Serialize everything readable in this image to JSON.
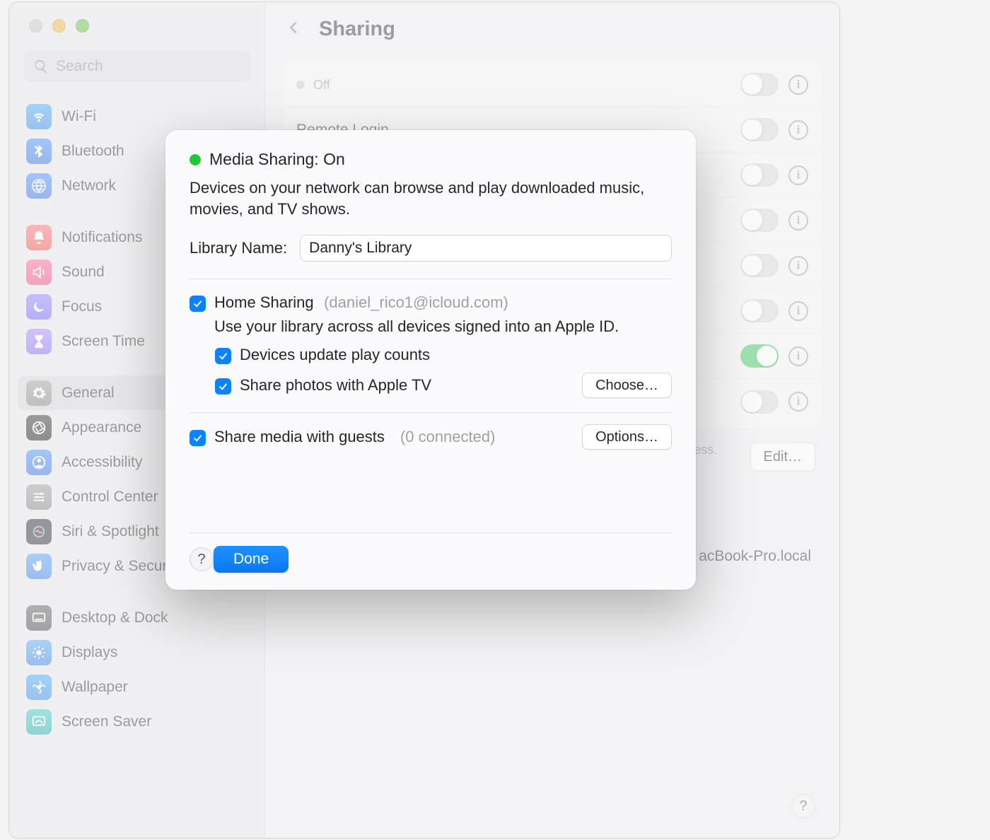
{
  "search_placeholder": "Search",
  "header": {
    "title": "Sharing"
  },
  "sidebar": {
    "groups": [
      [
        {
          "label": "Wi-Fi",
          "icon": "wifi-icon",
          "cls": "i-blue"
        },
        {
          "label": "Bluetooth",
          "icon": "bluetooth-icon",
          "cls": "i-blue2"
        },
        {
          "label": "Network",
          "icon": "globe-icon",
          "cls": "i-blue2"
        }
      ],
      [
        {
          "label": "Notifications",
          "icon": "bell-icon",
          "cls": "i-red"
        },
        {
          "label": "Sound",
          "icon": "speaker-icon",
          "cls": "i-pink"
        },
        {
          "label": "Focus",
          "icon": "moon-icon",
          "cls": "i-purp"
        },
        {
          "label": "Screen Time",
          "icon": "hourglass-icon",
          "cls": "i-pur2"
        }
      ],
      [
        {
          "label": "General",
          "icon": "gear-icon",
          "cls": "i-gray",
          "sel": true
        },
        {
          "label": "Appearance",
          "icon": "aperture-icon",
          "cls": "i-dark"
        },
        {
          "label": "Accessibility",
          "icon": "person-icon",
          "cls": "i-blue2"
        },
        {
          "label": "Control Center",
          "icon": "sliders-icon",
          "cls": "i-gray"
        },
        {
          "label": "Siri & Spotlight",
          "icon": "siri-icon",
          "cls": "i-siri"
        },
        {
          "label": "Privacy & Security",
          "icon": "hand-icon",
          "cls": "i-hand"
        }
      ],
      [
        {
          "label": "Desktop & Dock",
          "icon": "dock-icon",
          "cls": "i-dkgr"
        },
        {
          "label": "Displays",
          "icon": "sun-icon",
          "cls": "i-sun"
        },
        {
          "label": "Wallpaper",
          "icon": "flower-icon",
          "cls": "i-flower"
        },
        {
          "label": "Screen Saver",
          "icon": "screensaver-icon",
          "cls": "i-teal"
        }
      ]
    ]
  },
  "sharing_rows": [
    {
      "label": "",
      "sub": "Off",
      "on": false,
      "dot": true
    },
    {
      "label": "Remote Login",
      "on": false
    },
    {
      "label": "",
      "on": false
    },
    {
      "label": "",
      "on": false
    },
    {
      "label": "",
      "on": false
    },
    {
      "label": "",
      "on": false
    },
    {
      "label": "",
      "on": true
    },
    {
      "label": "",
      "on": false
    }
  ],
  "hostname_tail": "acBook-Pro.local",
  "hostname_desc": "Computers on your local network can access your computer at this address.",
  "edit_label": "Edit…",
  "modal": {
    "title": "Media Sharing: On",
    "desc": "Devices on your network can browse and play downloaded music, movies, and TV shows.",
    "library_label": "Library Name:",
    "library_value": "Danny's Library",
    "home_sharing": {
      "label": "Home Sharing",
      "account": "(daniel_rico1@icloud.com)",
      "desc": "Use your library across all devices signed into an Apple ID."
    },
    "play_counts": "Devices update play counts",
    "share_photos": "Share photos with Apple TV",
    "choose": "Choose…",
    "guests": {
      "label": "Share media with guests",
      "count": "(0 connected)"
    },
    "options": "Options…",
    "done": "Done"
  }
}
